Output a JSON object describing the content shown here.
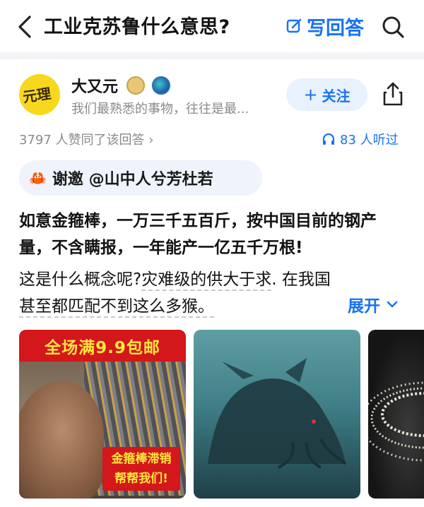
{
  "header": {
    "title": "工业克苏鲁什么意思?",
    "write_answer_label": "写回答"
  },
  "author": {
    "name": "大又元",
    "avatar_text": "元理",
    "bio": "我们最熟悉的事物，往往是最...",
    "follow_label": "关注"
  },
  "stats": {
    "likes": "3797 人赞同了该回答 ›",
    "listens": "83 人听过"
  },
  "invite": {
    "label": "谢邀 @山中人兮芳杜若"
  },
  "excerpt": {
    "bold": "如意金箍棒，一万三千五百斤，按中国目前的钢产量，不含瞒报，一年能产一亿五千万根!",
    "line1_a": "这是什么概念呢?",
    "line1_b": "灾难级的供大于求",
    "line1_c": ". 在我国",
    "line2": "甚至都匹配不到这么多猴。",
    "expand_label": "展开"
  },
  "images": {
    "img1_top_text": "全场满9.9包邮",
    "img1_bottom_line1": "金箍棒滞销",
    "img1_bottom_line2": "帮帮我们!"
  },
  "colors": {
    "accent": "#1772f6",
    "chip_bg": "#eef3fc",
    "promo_red": "#d3171a",
    "promo_yellow": "#ffe83a"
  }
}
